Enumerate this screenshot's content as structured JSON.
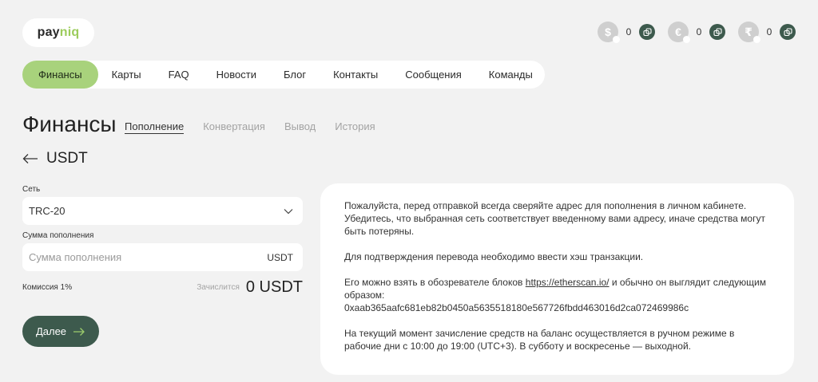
{
  "brand": {
    "part1": "pay",
    "part2": "niq"
  },
  "balances": [
    {
      "symbol": "$",
      "icon": "dollar-coin-icon",
      "value": "0"
    },
    {
      "symbol": "€",
      "icon": "euro-coin-icon",
      "value": "0"
    },
    {
      "symbol": "₹",
      "icon": "rupee-coin-icon",
      "value": "0"
    }
  ],
  "nav": [
    "Финансы",
    "Карты",
    "FAQ",
    "Новости",
    "Блог",
    "Контакты",
    "Сообщения",
    "Команды"
  ],
  "page": {
    "title": "Финансы",
    "tabs": [
      "Пополнение",
      "Конвертация",
      "Вывод",
      "История"
    ],
    "asset": "USDT"
  },
  "form": {
    "network_label": "Сеть",
    "network_value": "TRC-20",
    "amount_label": "Сумма пополнения",
    "amount_placeholder": "Сумма пополнения",
    "amount_unit": "USDT",
    "fee": "Комиссия 1%",
    "credited_label": "Зачислится",
    "credited_amount": "0",
    "credited_unit": "USDT",
    "next_button": "Далее"
  },
  "info": {
    "p1": "Пожалуйста, перед отправкой всегда сверяйте адрес для пополнения в личном кабинете. Убедитесь, что выбранная сеть соответствует введенному вами адресу, иначе средства могут быть потеряны.",
    "p2": "Для подтверждения перевода необходимо ввести хэш транзакции.",
    "p3_before": "Его можно взять в обозревателе блоков ",
    "p3_link": "https://etherscan.io/",
    "p3_after": " и обычно он выглядит следующим образом:",
    "p3_hash": "0xaab365aafc681eb82b0450a5635518180e567726fbdd463016d2ca072469986c",
    "p4": "На текущий момент зачисление средств на баланс осуществляется в ручном режиме в рабочие дни с 10:00 до 19:00 (UTC+3). В субботу и воскресенье — выходной."
  },
  "colors": {
    "accent": "#a8d27c",
    "dark": "#3d5a4d",
    "background": "#f2f2f2"
  }
}
